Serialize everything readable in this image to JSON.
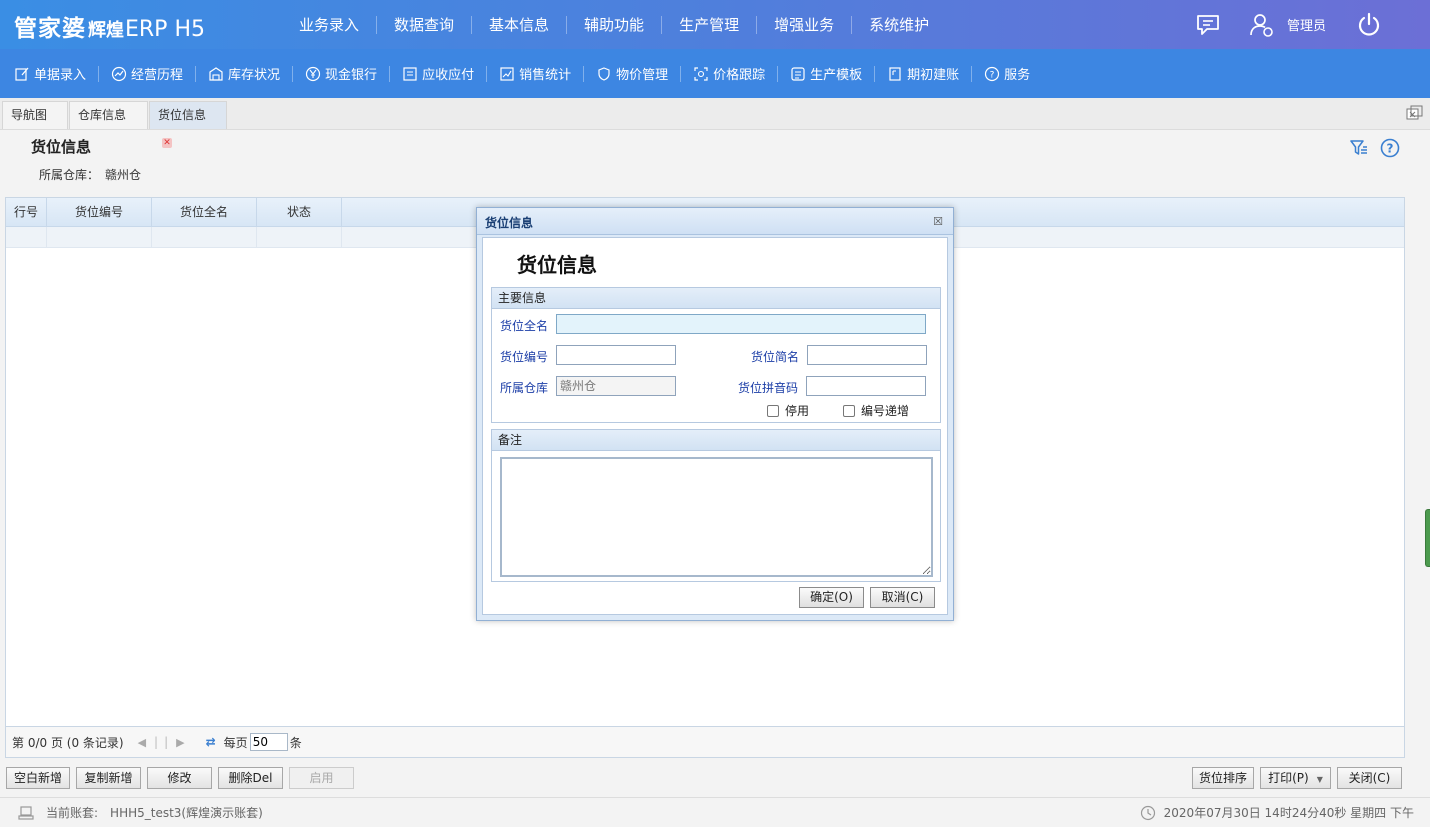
{
  "app": {
    "logo_main": "管家婆",
    "logo_sub": "辉煌",
    "logo_erp": "ERP H5",
    "top_nav": [
      "业务录入",
      "数据查询",
      "基本信息",
      "辅助功能",
      "生产管理",
      "增强业务",
      "系统维护"
    ],
    "user": "管理员"
  },
  "toolbar": [
    "单据录入",
    "经营历程",
    "库存状况",
    "现金银行",
    "应收应付",
    "销售统计",
    "物价管理",
    "价格跟踪",
    "生产模板",
    "期初建账",
    "服务"
  ],
  "tabs": [
    {
      "label": "导航图",
      "active": false
    },
    {
      "label": "仓库信息",
      "active": false
    },
    {
      "label": "货位信息",
      "active": true
    }
  ],
  "page": {
    "title": "货位信息",
    "warehouse_label": "所属仓库：",
    "warehouse_value": "赣州仓"
  },
  "grid": {
    "columns": [
      "行号",
      "货位编号",
      "货位全名",
      "状态"
    ],
    "rows": []
  },
  "pager": {
    "summary": "第 0/0 页 (0 条记录)",
    "per_page_label": "每页",
    "per_page_value": "50",
    "unit": "条"
  },
  "buttons": {
    "blank_new": "空白新增",
    "copy_new": "复制新增",
    "modify": "修改",
    "delete": "删除Del",
    "enable": "启用",
    "sort": "货位排序",
    "print": "打印(P)",
    "close": "关闭(C)"
  },
  "status": {
    "account_label": "当前账套:",
    "account_value": "HHH5_test3(辉煌演示账套)",
    "datetime": "2020年07月30日 14时24分40秒 星期四 下午"
  },
  "dialog": {
    "window_title": "货位信息",
    "heading": "货位信息",
    "section_main": "主要信息",
    "label_fullname": "货位全名",
    "label_code": "货位编号",
    "label_shortname": "货位简名",
    "label_warehouse": "所属仓库",
    "label_pinyin": "货位拼音码",
    "value_fullname": "",
    "value_code": "",
    "value_shortname": "",
    "value_warehouse": "赣州仓",
    "value_pinyin": "",
    "chk_disabled": "停用",
    "chk_autoincrement": "编号递增",
    "section_memo": "备注",
    "memo_value": "",
    "ok": "确定(O)",
    "cancel": "取消(C)"
  },
  "colors": {
    "header_gradient_start": "#3a8ee4",
    "header_gradient_end": "#6c6fd6",
    "toolbar_bg": "#3d86e2",
    "label_blue": "#1c3ea7"
  }
}
